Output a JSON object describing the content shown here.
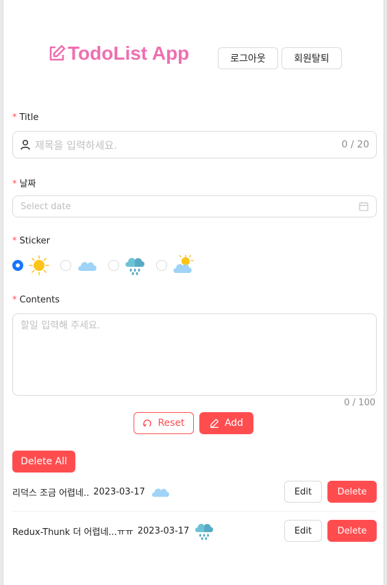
{
  "header": {
    "title": "TodoList App",
    "logout_label": "로그아웃",
    "withdraw_label": "회원탈퇴"
  },
  "form": {
    "title": {
      "label": "Title",
      "placeholder": "제목을 입력하세요.",
      "count": "0 / 20"
    },
    "date": {
      "label": "날짜",
      "placeholder": "Select date"
    },
    "sticker": {
      "label": "Sticker",
      "selected": "sunny",
      "options": [
        "sunny-icon",
        "cloud-icon",
        "rain-icon",
        "partly-cloudy-icon"
      ]
    },
    "contents": {
      "label": "Contents",
      "placeholder": "할일 입력해 주세요.",
      "count": "0 / 100"
    },
    "reset_label": "Reset",
    "add_label": "Add"
  },
  "list": {
    "delete_all_label": "Delete All",
    "items": [
      {
        "text": "리덕스  조금 어렵네..",
        "date": "2023-03-17",
        "icon": "cloud-icon",
        "edit_label": "Edit",
        "delete_label": "Delete"
      },
      {
        "text": "Redux-Thunk  더 어렵네...ㅠㅠ",
        "date": "2023-03-17",
        "icon": "rain-icon",
        "edit_label": "Edit",
        "delete_label": "Delete"
      }
    ]
  },
  "colors": {
    "brand": "#ee6fb0",
    "danger": "#ff4d4f",
    "primary": "#1677ff"
  }
}
